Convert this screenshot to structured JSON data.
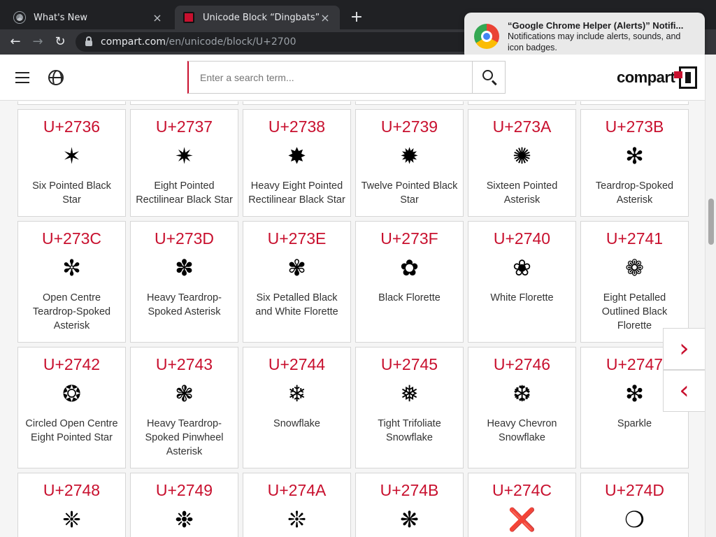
{
  "browser": {
    "tabs": [
      {
        "title": "What's New",
        "close": "×"
      },
      {
        "title": "Unicode Block “Dingbats”",
        "close": "×"
      }
    ],
    "new_tab": "+",
    "url_host": "compart.com",
    "url_path": "/en/unicode/block/U+2700",
    "back": "←",
    "forward": "→",
    "reload": "↻"
  },
  "notification": {
    "title": "“Google Chrome Helper (Alerts)” Notifi...",
    "body": "Notifications may include alerts, sounds, and icon badges."
  },
  "site": {
    "search_placeholder": "Enter a search term...",
    "brand": "compart"
  },
  "rows": [
    [
      {
        "code": "U+2736",
        "glyph": "✶",
        "name": "Six Pointed Black Star"
      },
      {
        "code": "U+2737",
        "glyph": "✷",
        "name": "Eight Pointed Rectilinear Black Star"
      },
      {
        "code": "U+2738",
        "glyph": "✸",
        "name": "Heavy Eight Pointed Rectilinear Black Star"
      },
      {
        "code": "U+2739",
        "glyph": "✹",
        "name": "Twelve Pointed Black Star"
      },
      {
        "code": "U+273A",
        "glyph": "✺",
        "name": "Sixteen Pointed Asterisk"
      },
      {
        "code": "U+273B",
        "glyph": "✻",
        "name": "Teardrop-Spoked Asterisk"
      }
    ],
    [
      {
        "code": "U+273C",
        "glyph": "✼",
        "name": "Open Centre Teardrop-Spoked Asterisk"
      },
      {
        "code": "U+273D",
        "glyph": "✽",
        "name": "Heavy Teardrop-Spoked Asterisk"
      },
      {
        "code": "U+273E",
        "glyph": "✾",
        "name": "Six Petalled Black and White Florette"
      },
      {
        "code": "U+273F",
        "glyph": "✿",
        "name": "Black Florette"
      },
      {
        "code": "U+2740",
        "glyph": "❀",
        "name": "White Florette"
      },
      {
        "code": "U+2741",
        "glyph": "❁",
        "name": "Eight Petalled Outlined Black Florette"
      }
    ],
    [
      {
        "code": "U+2742",
        "glyph": "❂",
        "name": "Circled Open Centre Eight Pointed Star"
      },
      {
        "code": "U+2743",
        "glyph": "❃",
        "name": "Heavy Teardrop-Spoked Pinwheel Asterisk"
      },
      {
        "code": "U+2744",
        "glyph": "❄",
        "name": "Snowflake"
      },
      {
        "code": "U+2745",
        "glyph": "❅",
        "name": "Tight Trifoliate Snowflake"
      },
      {
        "code": "U+2746",
        "glyph": "❆",
        "name": "Heavy Chevron Snowflake"
      },
      {
        "code": "U+2747",
        "glyph": "❇",
        "name": "Sparkle"
      }
    ],
    [
      {
        "code": "U+2748",
        "glyph": "❈",
        "name": ""
      },
      {
        "code": "U+2749",
        "glyph": "❉",
        "name": ""
      },
      {
        "code": "U+274A",
        "glyph": "❊",
        "name": ""
      },
      {
        "code": "U+274B",
        "glyph": "❋",
        "name": ""
      },
      {
        "code": "U+274C",
        "glyph": "❌",
        "name": ""
      },
      {
        "code": "U+274D",
        "glyph": "❍",
        "name": ""
      }
    ]
  ],
  "side_nav": {
    "next": "›",
    "prev": "‹"
  },
  "icons": {
    "menu": "hamburger-menu-icon",
    "language": "globe-icon",
    "search": "search-icon"
  },
  "colors": {
    "accent": "#c8102e",
    "tabstrip": "#202124",
    "toolbar": "#35363a"
  }
}
